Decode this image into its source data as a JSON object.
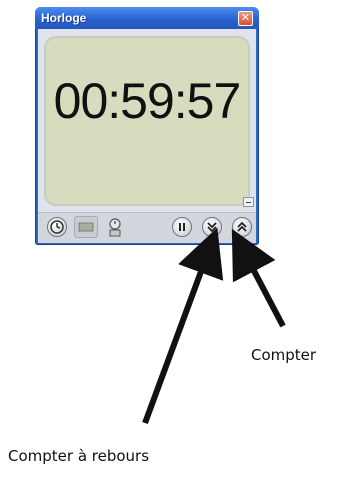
{
  "window": {
    "title": "Horloge",
    "time": "00:59:57"
  },
  "toolbar": {
    "icons": [
      "clock-icon",
      "stopwatch-icon",
      "alarm-icon",
      "pause-icon",
      "count-down-icon",
      "count-up-icon"
    ]
  },
  "annotations": {
    "count_up": "Compter",
    "count_down": "Compter à rebours"
  },
  "colors": {
    "titlebar": "#2a62cf",
    "display_bg": "#d8dcbf",
    "close": "#d9502c"
  }
}
